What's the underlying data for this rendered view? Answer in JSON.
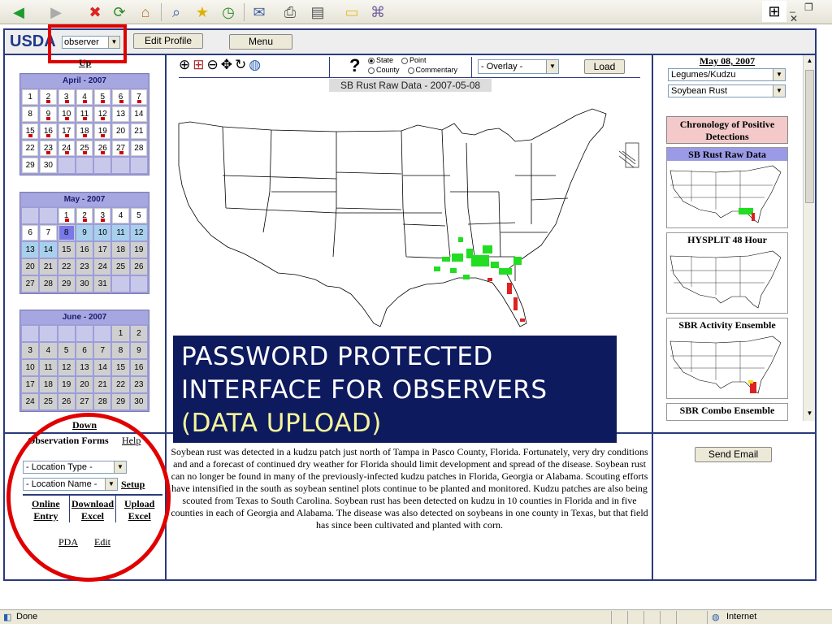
{
  "browser": {
    "status_text": "Done",
    "zone_text": "Internet"
  },
  "header": {
    "brand": "USDA",
    "role_value": "observer",
    "edit_profile_label": "Edit Profile",
    "menu_label": "Menu"
  },
  "left": {
    "up_label": "Up",
    "down_label": "Down",
    "calendars": [
      {
        "title": "April - 2007",
        "lead_blanks": 0,
        "days": [
          "1",
          "2",
          "3",
          "4",
          "5",
          "6",
          "7",
          "8",
          "9",
          "10",
          "11",
          "12",
          "13",
          "14",
          "15",
          "16",
          "17",
          "18",
          "19",
          "20",
          "21",
          "22",
          "23",
          "24",
          "25",
          "26",
          "27",
          "28",
          "29",
          "30"
        ],
        "flagged": [
          "2",
          "3",
          "4",
          "5",
          "6",
          "7",
          "9",
          "10",
          "11",
          "12",
          "15",
          "16",
          "17",
          "18",
          "19",
          "23",
          "24",
          "25",
          "26",
          "27"
        ],
        "trail_blanks": 5
      },
      {
        "title": "May - 2007",
        "lead_blanks": 2,
        "days": [
          "1",
          "2",
          "3",
          "4",
          "5",
          "6",
          "7",
          "8",
          "9",
          "10",
          "11",
          "12",
          "13",
          "14",
          "15",
          "16",
          "17",
          "18",
          "19",
          "20",
          "21",
          "22",
          "23",
          "24",
          "25",
          "26",
          "27",
          "28",
          "29",
          "30",
          "31"
        ],
        "flagged": [
          "1",
          "2",
          "3"
        ],
        "selected": "8",
        "highlight": [
          "9",
          "10",
          "11",
          "12",
          "13",
          "14"
        ],
        "gray": [
          "15",
          "16",
          "17",
          "18",
          "19",
          "20",
          "21",
          "22",
          "23",
          "24",
          "25",
          "26",
          "27",
          "28",
          "29",
          "30",
          "31"
        ],
        "trail_blanks": 2
      },
      {
        "title": "June - 2007",
        "lead_blanks": 5,
        "days": [
          "1",
          "2",
          "3",
          "4",
          "5",
          "6",
          "7",
          "8",
          "9",
          "10",
          "11",
          "12",
          "13",
          "14",
          "15",
          "16",
          "17",
          "18",
          "19",
          "20",
          "21",
          "22",
          "23",
          "24",
          "25",
          "26",
          "27",
          "28",
          "29",
          "30"
        ],
        "flagged": [],
        "gray": [
          "1",
          "2",
          "3",
          "4",
          "5",
          "6",
          "7",
          "8",
          "9",
          "10",
          "11",
          "12",
          "13",
          "14",
          "15",
          "16",
          "17",
          "18",
          "19",
          "20",
          "21",
          "22",
          "23",
          "24",
          "25",
          "26",
          "27",
          "28",
          "29",
          "30"
        ],
        "trail_blanks": 0
      }
    ],
    "obs_forms_title": "Observation Forms",
    "help_label": "Help",
    "location_type_value": "- Location Type -",
    "location_name_value": "- Location Name -",
    "setup_label": "Setup",
    "actions": [
      {
        "line1": "Online",
        "line2": "Entry"
      },
      {
        "line1": "Download",
        "line2": "Excel"
      },
      {
        "line1": "Upload",
        "line2": "Excel"
      }
    ],
    "pda_label": "PDA",
    "edit_label": "Edit"
  },
  "map": {
    "radio_state": "State",
    "radio_point": "Point",
    "radio_county": "County",
    "radio_commentary": "Commentary",
    "overlay_value": "- Overlay -",
    "load_label": "Load",
    "title": "SB Rust Raw Data - 2007-05-08"
  },
  "banner": {
    "line1": "PASSWORD PROTECTED",
    "line2": "INTERFACE FOR OBSERVERS",
    "line3": "(DATA UPLOAD)"
  },
  "commentary": {
    "text": "Soybean rust was detected in a kudzu patch just north of Tampa in Pasco County, Florida. Fortunately, very dry conditions and and a forecast of continued dry weather for Florida should limit development and spread of the disease. Soybean rust can no longer be found in many of the previously-infected kudzu patches in Florida, Georgia or Alabama. Scouting efforts have intensified in the south as soybean sentinel plots continue to be planted and monitored. Kudzu patches are also being scouted from Texas to South Carolina. Soybean rust has been detected on kudzu in 10 counties in Florida and in five counties in each of Georgia and Alabama. The disease was also detected on soybeans in one county in Texas, but that field has since been cultivated and planted with corn."
  },
  "right": {
    "date": "May 08, 2007",
    "host_value": "Legumes/Kudzu",
    "pathogen_value": "Soybean Rust",
    "chronology_label": "Chronology of Positive Detections",
    "thumbnails": [
      {
        "label": "SB Rust Raw Data"
      },
      {
        "label": "HYSPLIT 48 Hour"
      },
      {
        "label": "SBR Activity Ensemble"
      },
      {
        "label": "SBR Combo Ensemble"
      }
    ],
    "send_email_label": "Send Email"
  }
}
